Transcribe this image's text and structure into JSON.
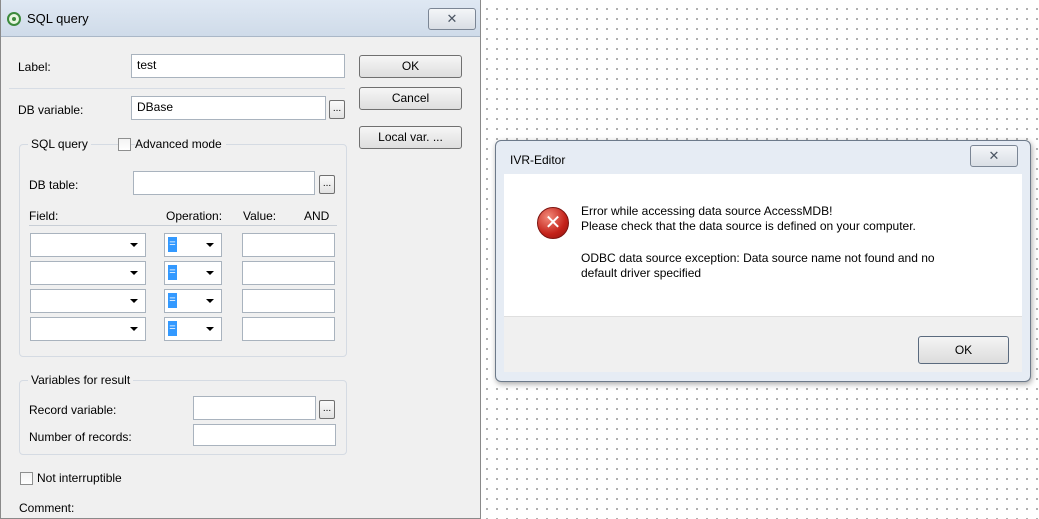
{
  "sql_dialog": {
    "title": "SQL query",
    "close_glyph": "✕",
    "label_caption": "Label:",
    "label_value": "test",
    "db_variable_caption": "DB variable:",
    "db_variable_value": "DBase",
    "browse_glyph": "...",
    "buttons": {
      "ok": "OK",
      "cancel": "Cancel",
      "local_var": "Local var. ..."
    },
    "sql_group": {
      "title": "SQL query",
      "advanced_mode": "Advanced mode",
      "db_table_caption": "DB table:",
      "db_table_value": "",
      "columns": {
        "field": "Field:",
        "operation": "Operation:",
        "value": "Value:",
        "and": "AND"
      },
      "rows": [
        {
          "field": "",
          "operation": "=",
          "value": ""
        },
        {
          "field": "",
          "operation": "=",
          "value": ""
        },
        {
          "field": "",
          "operation": "=",
          "value": ""
        },
        {
          "field": "",
          "operation": "=",
          "value": ""
        }
      ]
    },
    "result_group": {
      "title": "Variables for result",
      "record_variable": "Record variable:",
      "number_of_records": "Number of records:"
    },
    "not_interruptible": "Not interruptible",
    "comment": "Comment:"
  },
  "error_dialog": {
    "title": "IVR-Editor",
    "close_glyph": "✕",
    "icon_glyph": "✕",
    "line1": "Error while accessing data source AccessMDB!",
    "line2": "Please check that the data source is defined on your computer.",
    "line3": "ODBC data source exception: Data source name not found and no",
    "line4": "default driver specified",
    "ok": "OK"
  },
  "icons": [
    "green-circle-icon",
    "close-icon",
    "error-icon",
    "dropdown-arrow-icon"
  ],
  "colors": {
    "selection": "#3399ff",
    "error_red": "#c4221a",
    "title_bar": "#dfe8f3"
  }
}
